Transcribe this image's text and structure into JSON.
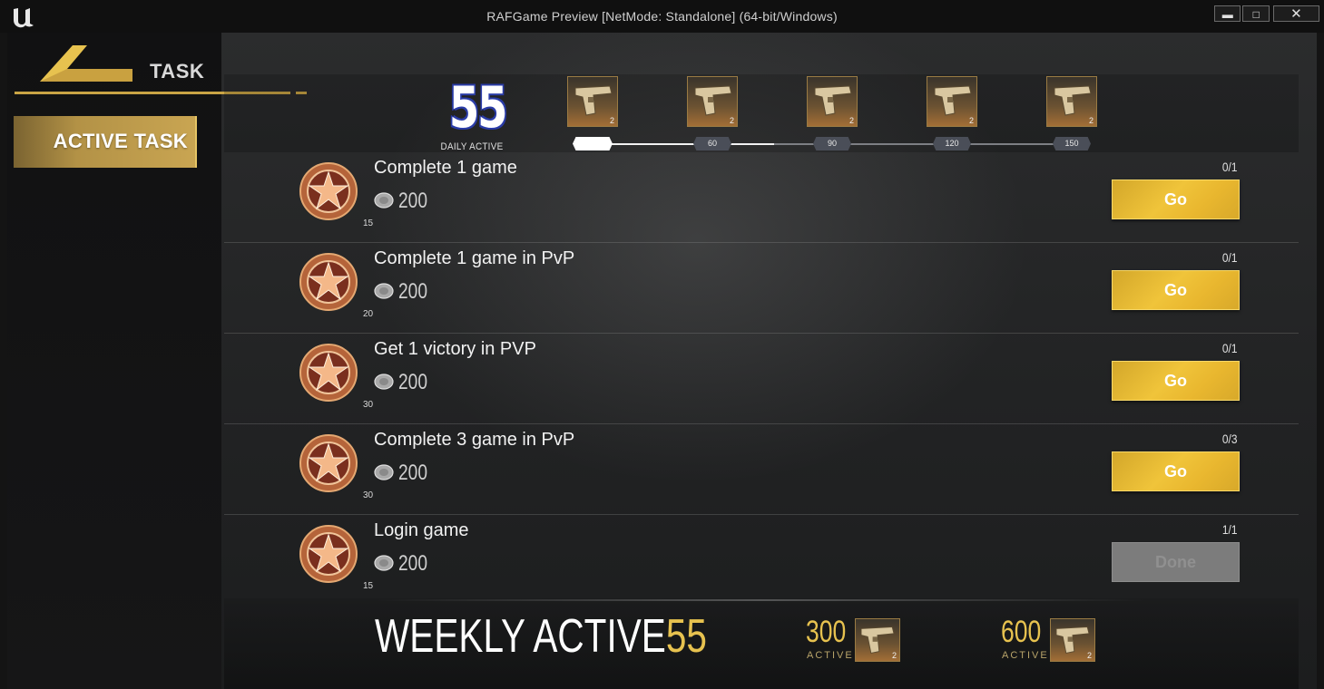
{
  "window": {
    "title": "RAFGame Preview [NetMode: Standalone]  (64-bit/Windows)",
    "minimize_label": "▬",
    "maximize_label": "□",
    "close_label": "✕"
  },
  "sidebar": {
    "header": "TASK",
    "active_item": "ACTIVE TASK"
  },
  "daily": {
    "value": "55",
    "label": "DAILY ACTIVE",
    "rewards": [
      {
        "count": "2",
        "icon": "pistol-icon"
      },
      {
        "count": "2",
        "icon": "pistol-icon"
      },
      {
        "count": "2",
        "icon": "pistol-icon"
      },
      {
        "count": "2",
        "icon": "pistol-icon"
      },
      {
        "count": "2",
        "icon": "pistol-icon"
      }
    ],
    "milestones": [
      "60",
      "90",
      "120",
      "150"
    ]
  },
  "tasks": [
    {
      "name": "Complete 1 game",
      "points": "15",
      "coins": "200",
      "progress": "0/1",
      "action": "Go",
      "done": false
    },
    {
      "name": "Complete 1 game in PvP",
      "points": "20",
      "coins": "200",
      "progress": "0/1",
      "action": "Go",
      "done": false
    },
    {
      "name": "Get 1 victory in PVP",
      "points": "30",
      "coins": "200",
      "progress": "0/1",
      "action": "Go",
      "done": false
    },
    {
      "name": "Complete 3 game in PvP",
      "points": "30",
      "coins": "200",
      "progress": "0/3",
      "action": "Go",
      "done": false
    },
    {
      "name": "Login game",
      "points": "15",
      "coins": "200",
      "progress": "1/1",
      "action": "Done",
      "done": true
    }
  ],
  "weekly": {
    "label": "WEEKLY ACTIVE",
    "value": "55",
    "milestones": [
      {
        "value": "300",
        "label": "ACTIVE",
        "count": "2",
        "icon": "pistol-icon"
      },
      {
        "value": "600",
        "label": "ACTIVE",
        "count": "2",
        "icon": "pistol-icon"
      }
    ]
  },
  "colors": {
    "accent_gold": "#e7c24f",
    "go_button": "#f0c43a",
    "done_button": "#7c7c7c",
    "daily_outline": "#2b3ca5"
  }
}
